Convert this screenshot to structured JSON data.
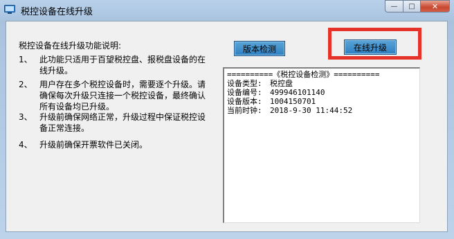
{
  "window": {
    "title": "税控设备在线升级",
    "caption": {
      "minimize": "—",
      "maximize": "□",
      "close": "✕"
    }
  },
  "info": {
    "title": "税控设备在线升级功能说明:",
    "items": [
      {
        "num": "1、",
        "text": "此功能只适用于百望税控盘、报税盘设备的在线升级。"
      },
      {
        "num": "2、",
        "text": "用户存在多个税控设备时，需要逐个升级。请确保每次升级只连接一个税控设备，最终确认所有设备均已升级。"
      },
      {
        "num": "3、",
        "text": "升级前确保网络正常，升级过程中保证税控设备正常连接。"
      },
      {
        "num": "4、",
        "text": "升级前确保开票软件已关闭。"
      }
    ]
  },
  "buttons": {
    "version_check": "版本检测",
    "online_upgrade": "在线升级"
  },
  "log": {
    "header": "==========《税控设备检测》==========",
    "rows": [
      {
        "key": "设备类型:",
        "value": "税控盘"
      },
      {
        "key": "设备编号:",
        "value": "499946101140"
      },
      {
        "key": "设备版本:",
        "value": "1004150701"
      },
      {
        "key": "当前时钟:",
        "value": "2018-9-30 11:44:52"
      }
    ]
  },
  "colors": {
    "highlight_border": "#e5332a",
    "button_blue": "#2f7fc0"
  }
}
